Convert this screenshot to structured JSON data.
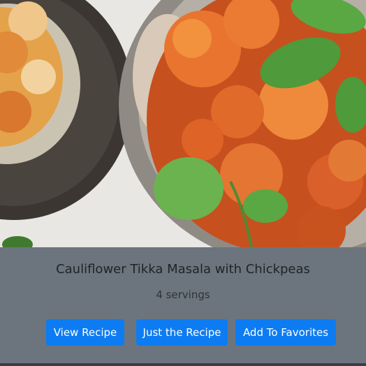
{
  "recipe": {
    "title": "Cauliflower Tikka Masala with Chickpeas",
    "servings": "4 servings",
    "image_alt": "cauliflower-tikka-masala-photo"
  },
  "actions": {
    "view_recipe": "View Recipe",
    "just_the_recipe": "Just the Recipe",
    "add_to_favorites": "Add To Favorites"
  },
  "colors": {
    "button": "#0d7cf2",
    "card_body": "#6c757d"
  }
}
